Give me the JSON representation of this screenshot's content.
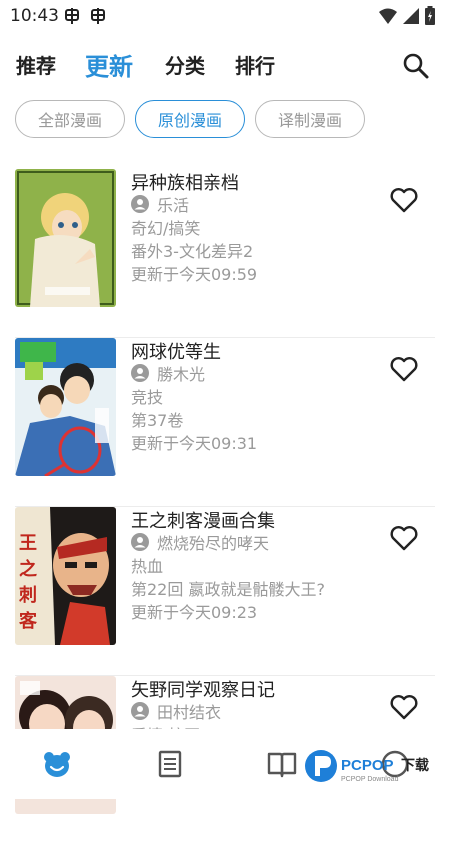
{
  "status_bar": {
    "time": "10:43",
    "notif_icons": [
      "bug-icon",
      "bug-icon"
    ],
    "system_icons": [
      "wifi-icon",
      "signal-icon",
      "battery-icon"
    ]
  },
  "top_tabs": [
    {
      "label": "推荐",
      "active": false
    },
    {
      "label": "更新",
      "active": true
    },
    {
      "label": "分类",
      "active": false
    },
    {
      "label": "排行",
      "active": false
    }
  ],
  "filter_chips": [
    {
      "label": "全部漫画",
      "active": false
    },
    {
      "label": "原创漫画",
      "active": true
    },
    {
      "label": "译制漫画",
      "active": false
    }
  ],
  "comics": [
    {
      "title": "异种族相亲档",
      "author": "乐活",
      "genre": "奇幻/搞笑",
      "chapter": "番外3-文化差异2",
      "updated": "更新于今天09:59"
    },
    {
      "title": "网球优等生",
      "author": "勝木光",
      "genre": "竞技",
      "chapter": "第37卷",
      "updated": "更新于今天09:31"
    },
    {
      "title": "王之刺客漫画合集",
      "author": "燃烧殆尽的哮天",
      "genre": "热血",
      "chapter": "第22回 嬴政就是骷髅大王?",
      "updated": "更新于今天09:23"
    },
    {
      "title": "矢野同学观察日记",
      "author": "田村结衣",
      "genre": "爱情,校园",
      "chapter": "",
      "updated": ""
    }
  ],
  "bottom_nav": [
    "home-bear-icon",
    "news-icon",
    "book-icon",
    "profile-icon"
  ],
  "colors": {
    "accent": "#2a8fd8",
    "text": "#222222",
    "muted": "#9a9a9a",
    "chip_border": "#b8b8b8"
  }
}
